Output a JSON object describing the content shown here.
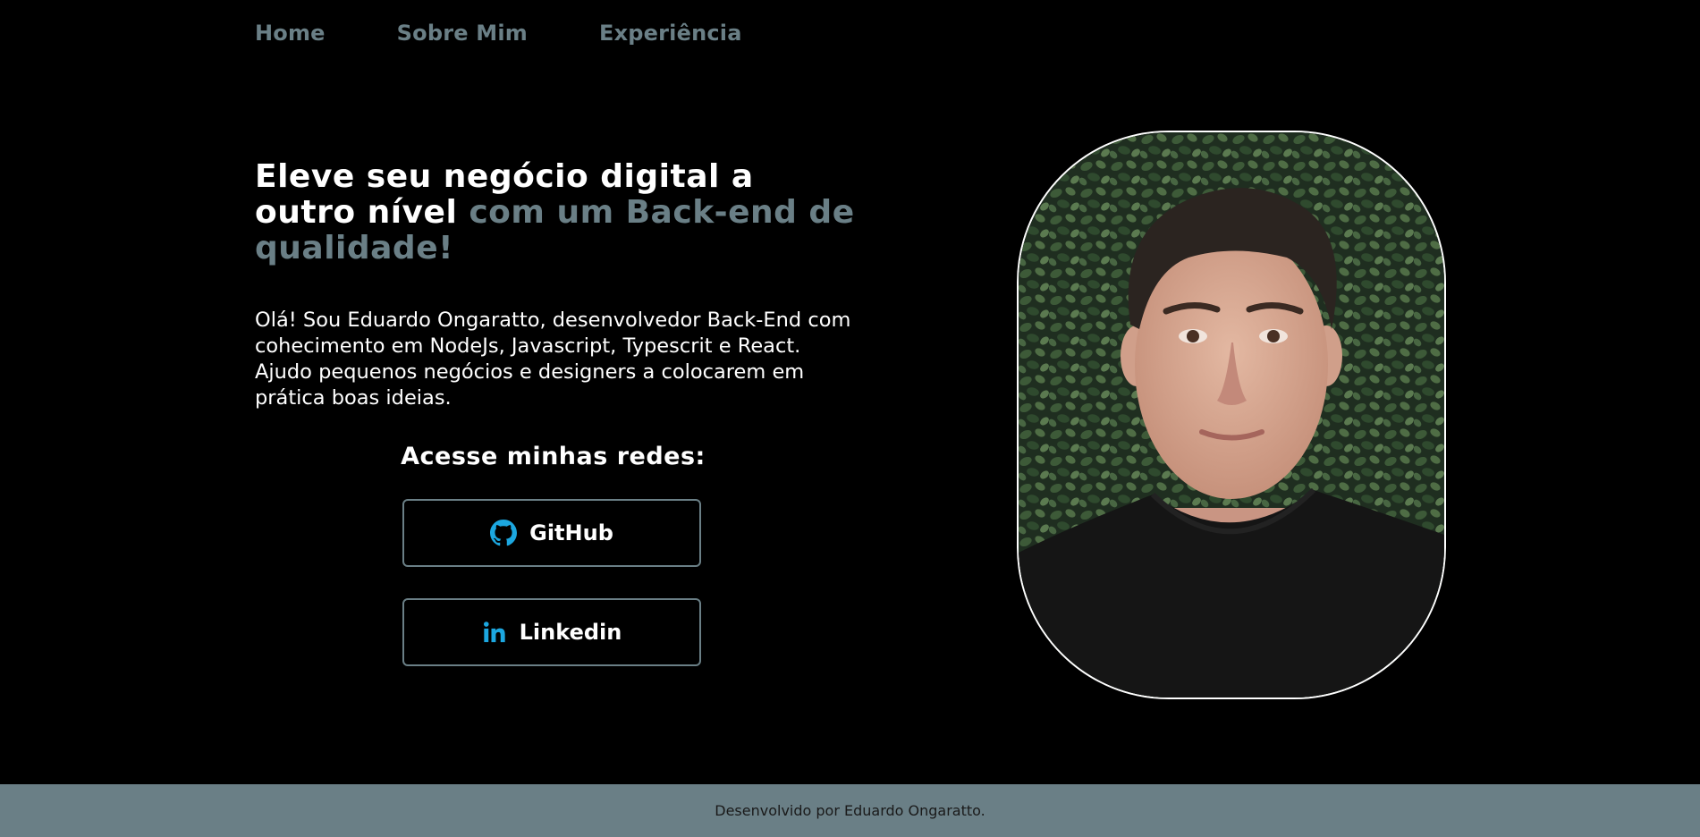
{
  "nav": {
    "items": [
      {
        "label": "Home"
      },
      {
        "label": "Sobre Mim"
      },
      {
        "label": "Experiência"
      }
    ]
  },
  "hero": {
    "headline_part1": "Eleve seu negócio digital a outro nível ",
    "headline_accent": "com um Back-end de qualidade!",
    "intro": "Olá! Sou Eduardo Ongaratto, desenvolvedor Back-End com cohecimento em NodeJs, Javascript, Typescrit e React. Ajudo pequenos negócios e designers a colocarem em prática boas ideias."
  },
  "social": {
    "title": "Acesse minhas redes:",
    "github_label": "GitHub",
    "github_icon": "github-icon",
    "linkedin_label": "Linkedin",
    "linkedin_icon": "linkedin-icon"
  },
  "footer": {
    "text": "Desenvolvido por Eduardo Ongaratto."
  },
  "colors": {
    "background": "#000000",
    "accent": "#6a7f86",
    "icon": "#1ca7e0",
    "text": "#ffffff"
  }
}
